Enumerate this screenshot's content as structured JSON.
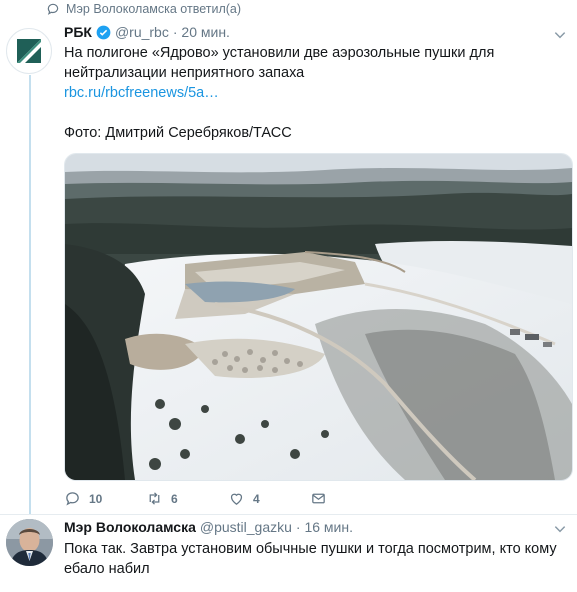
{
  "context": {
    "label": "Мэр Волоколамска ответил(а)"
  },
  "tweet1": {
    "name": "РБК",
    "handle": "@ru_rbc",
    "time": "· 20 мин.",
    "text_line1": "На полигоне «Ядрово» установили две аэрозольные пушки для",
    "text_line2": "нейтрализации неприятного запаха",
    "link": "rbc.ru/rbcfreenews/5a…",
    "photo_credit": "Фото: Дмитрий Серебряков/ТАСС",
    "replies": "10",
    "retweets": "6",
    "likes": "4"
  },
  "tweet2": {
    "name": "Мэр Волоколамска",
    "handle": "@pustil_gazku",
    "time": "· 16 мин.",
    "text_line1": "Пока так. Завтра установим обычные пушки и тогда посмотрим, кто кому",
    "text_line2": "ебало набил"
  },
  "colors": {
    "accent": "#1b95e0",
    "muted": "#657786",
    "thread": "#c4dfee",
    "verified": "#1da1f2"
  }
}
